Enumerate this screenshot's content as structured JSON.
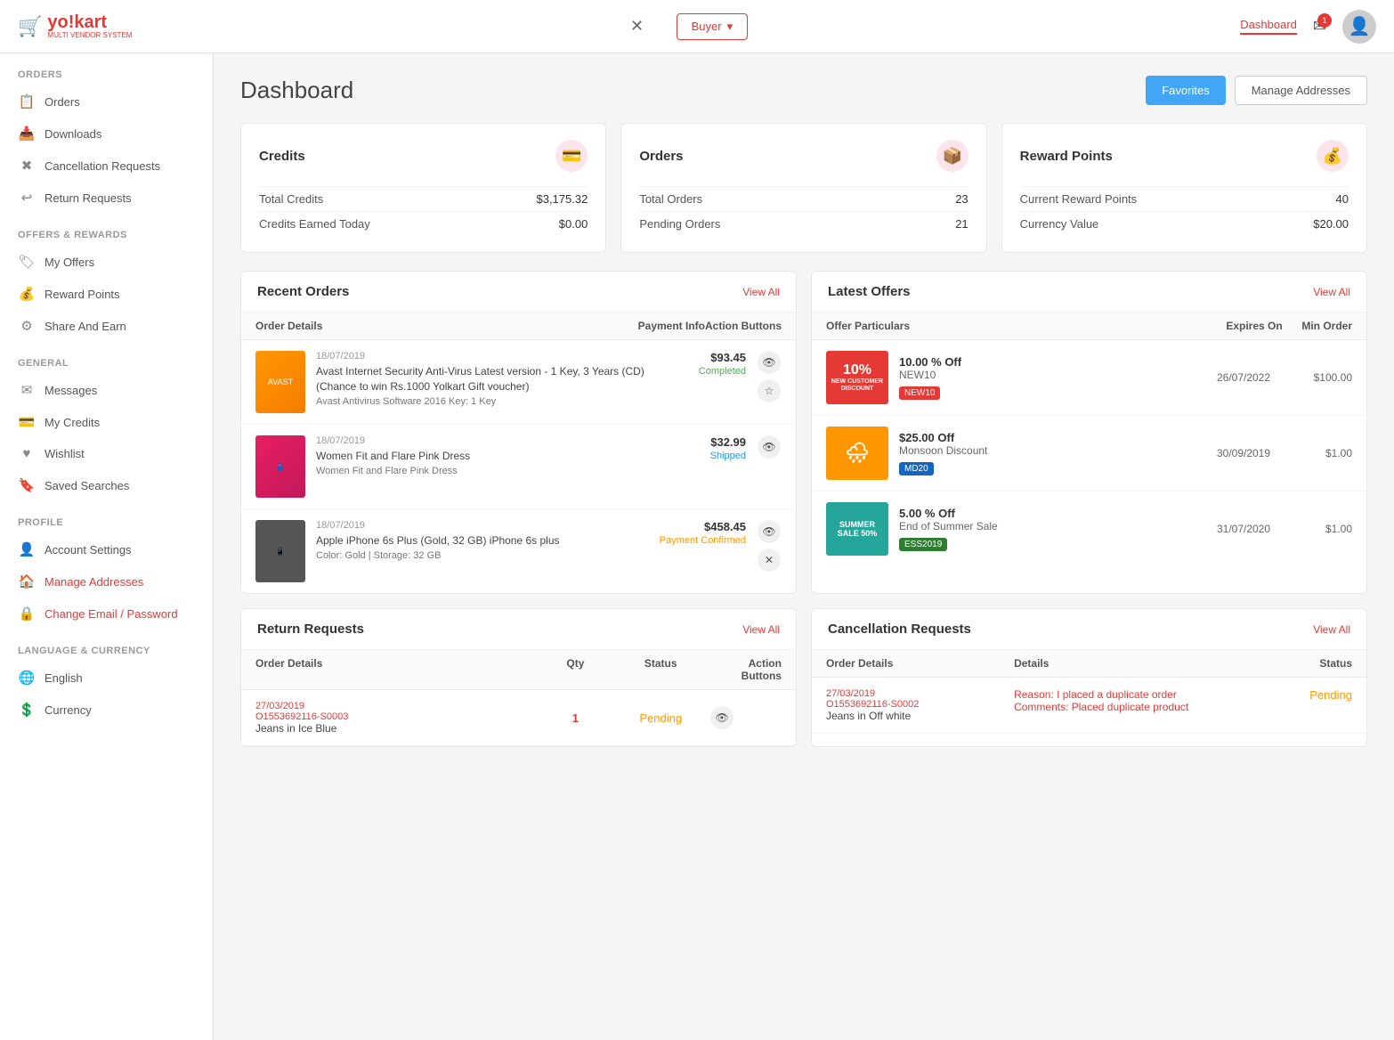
{
  "app": {
    "name": "yo!kart",
    "subtitle": "MULTI VENDOR SYSTEM"
  },
  "topbar": {
    "buyer_label": "Buyer",
    "dashboard_link": "Dashboard",
    "notification_count": "1",
    "close_btn": "✕"
  },
  "sidebar": {
    "sections": [
      {
        "title": "ORDERS",
        "items": [
          {
            "label": "Orders",
            "icon": "📋"
          },
          {
            "label": "Downloads",
            "icon": "📥"
          },
          {
            "label": "Cancellation Requests",
            "icon": "✖"
          },
          {
            "label": "Return Requests",
            "icon": "↩"
          }
        ]
      },
      {
        "title": "OFFERS & REWARDS",
        "items": [
          {
            "label": "My Offers",
            "icon": "🏷"
          },
          {
            "label": "Reward Points",
            "icon": "💰"
          },
          {
            "label": "Share And Earn",
            "icon": "⚙"
          }
        ]
      },
      {
        "title": "GENERAL",
        "items": [
          {
            "label": "Messages",
            "icon": "✉"
          },
          {
            "label": "My Credits",
            "icon": "💳"
          },
          {
            "label": "Wishlist",
            "icon": "♥"
          },
          {
            "label": "Saved Searches",
            "icon": "🔖"
          }
        ]
      },
      {
        "title": "PROFILE",
        "items": [
          {
            "label": "Account Settings",
            "icon": "👤"
          },
          {
            "label": "Manage Addresses",
            "icon": "🏠"
          },
          {
            "label": "Change Email / Password",
            "icon": "🔒"
          }
        ]
      },
      {
        "title": "LANGUAGE & CURRENCY",
        "items": [
          {
            "label": "English",
            "icon": "🌐"
          },
          {
            "label": "Currency",
            "icon": "💲"
          }
        ]
      }
    ]
  },
  "page": {
    "title": "Dashboard",
    "favorites_btn": "Favorites",
    "manage_addresses_btn": "Manage Addresses"
  },
  "summary": {
    "credits": {
      "title": "Credits",
      "icon": "💳",
      "rows": [
        {
          "label": "Total Credits",
          "value": "$3,175.32"
        },
        {
          "label": "Credits Earned Today",
          "value": "$0.00"
        }
      ]
    },
    "orders": {
      "title": "Orders",
      "icon": "📦",
      "rows": [
        {
          "label": "Total Orders",
          "value": "23"
        },
        {
          "label": "Pending Orders",
          "value": "21"
        }
      ]
    },
    "rewards": {
      "title": "Reward Points",
      "icon": "💰",
      "rows": [
        {
          "label": "Current Reward Points",
          "value": "40"
        },
        {
          "label": "Currency Value",
          "value": "$20.00"
        }
      ]
    }
  },
  "recent_orders": {
    "title": "Recent Orders",
    "view_all": "View All",
    "col_payment": "Payment Info",
    "col_action": "Action Buttons",
    "col_details": "Order Details",
    "items": [
      {
        "date": "18/07/2019",
        "name": "Avast Internet Security Anti-Virus Latest version - 1 Key, 3 Years (CD) (Chance to win Rs.1000 Yolkart Gift voucher)",
        "meta": "Avast Antivirus Software 2016 Key: 1 Key",
        "price": "$93.45",
        "status": "Completed",
        "status_class": "status-completed",
        "color": "#f57c00"
      },
      {
        "date": "18/07/2019",
        "name": "Women Fit and Flare Pink Dress",
        "meta": "Women Fit and Flare Pink Dress",
        "price": "$32.99",
        "status": "Shipped",
        "status_class": "status-shipped",
        "color": "#e91e63"
      },
      {
        "date": "18/07/2019",
        "name": "Apple iPhone 6s Plus (Gold, 32 GB) iPhone 6s plus",
        "meta": "Color: Gold | Storage: 32 GB",
        "price": "$458.45",
        "status": "Payment Confirmed",
        "status_class": "status-confirmed",
        "color": "#555"
      }
    ]
  },
  "latest_offers": {
    "title": "Latest Offers",
    "view_all": "View All",
    "col_particulars": "Offer Particulars",
    "col_expires": "Expires On",
    "col_minorder": "Min Order",
    "items": [
      {
        "discount": "10.00 % Off",
        "name": "NEW10",
        "code": "NEW10",
        "expires": "26/07/2022",
        "min_order": "$100.00",
        "bg": "#e53935",
        "label": "10%",
        "sub": "NEW CUSTOMER DISCOUNT"
      },
      {
        "discount": "$25.00 Off",
        "name": "Monsoon Discount",
        "code": "MD20",
        "expires": "30/09/2019",
        "min_order": "$1.00",
        "bg": "#ff9800",
        "label": "🌧",
        "sub": ""
      },
      {
        "discount": "5.00 % Off",
        "name": "End of Summer Sale",
        "code": "ESS2019",
        "expires": "31/07/2020",
        "min_order": "$1.00",
        "bg": "#26a69a",
        "label": "SUMMER SALE",
        "sub": ""
      }
    ]
  },
  "return_requests": {
    "title": "Return Requests",
    "view_all": "View All",
    "col_order": "Order Details",
    "col_qty": "Qty",
    "col_status": "Status",
    "col_action": "Action Buttons",
    "items": [
      {
        "date": "27/03/2019",
        "order_id": "O1553692116-S0003",
        "name": "Jeans in Ice Blue",
        "qty": "1",
        "status": "Pending"
      }
    ]
  },
  "cancellation_requests": {
    "title": "Cancellation Requests",
    "view_all": "View All",
    "col_order": "Order Details",
    "col_details": "Details",
    "col_status": "Status",
    "items": [
      {
        "date": "27/03/2019",
        "order_id": "O1553692116-S0002",
        "name": "Jeans in Off white",
        "reason": "Reason: I placed a duplicate order",
        "comments": "Comments: Placed duplicate product",
        "status": "Pending"
      }
    ]
  }
}
